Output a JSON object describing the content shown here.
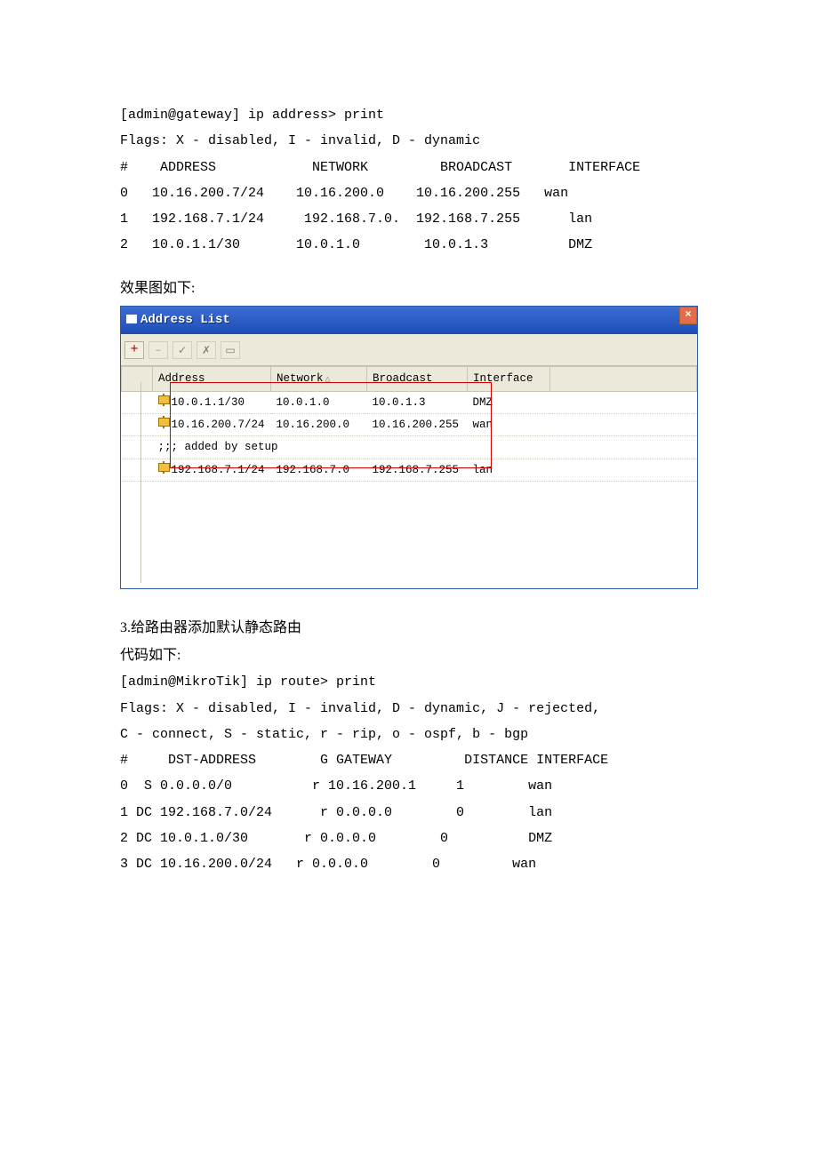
{
  "block1": {
    "line1": "[admin@gateway] ip address> print",
    "line2": "Flags: X - disabled, I - invalid, D - dynamic",
    "hdr": "#    ADDRESS            NETWORK         BROADCAST       INTERFACE",
    "r0": "0   10.16.200.7/24    10.16.200.0    10.16.200.255   wan",
    "r1": "1   192.168.7.1/24     192.168.7.0.  192.168.7.255      lan",
    "r2": "2   10.0.1.1/30       10.0.1.0        10.0.1.3          DMZ"
  },
  "caption1": "效果图如下:",
  "win": {
    "title": "Address List",
    "th": {
      "addr": "Address",
      "net": "Network",
      "bcast": "Broadcast",
      "iface": "Interface"
    },
    "rows": [
      {
        "addr": "10.0.1.1/30",
        "net": "10.0.1.0",
        "bcast": "10.0.1.3",
        "iface": "DMZ"
      },
      {
        "addr": "10.16.200.7/24",
        "net": "10.16.200.0",
        "bcast": "10.16.200.255",
        "iface": "wan"
      }
    ],
    "comment": ";;; added by setup",
    "row3": {
      "addr": "192.168.7.1/24",
      "net": "192.168.7.0",
      "bcast": "192.168.7.255",
      "iface": "lan"
    }
  },
  "block2": {
    "h": "3.给路由器添加默认静态路由",
    "cap": "代码如下:",
    "l1": "[admin@MikroTik] ip route> print",
    "l2": "Flags: X - disabled, I - invalid, D - dynamic, J - rejected,",
    "l3": "C - connect, S - static, r - rip, o - ospf, b - bgp",
    "hdr": "#     DST-ADDRESS        G GATEWAY         DISTANCE INTERFACE",
    "r0": "0  S 0.0.0.0/0          r 10.16.200.1     1        wan",
    "r1": "1 DC 192.168.7.0/24      r 0.0.0.0        0        lan",
    "r2": "2 DC 10.0.1.0/30       r 0.0.0.0        0          DMZ",
    "r3": "3 DC 10.16.200.0/24   r 0.0.0.0        0         wan"
  }
}
